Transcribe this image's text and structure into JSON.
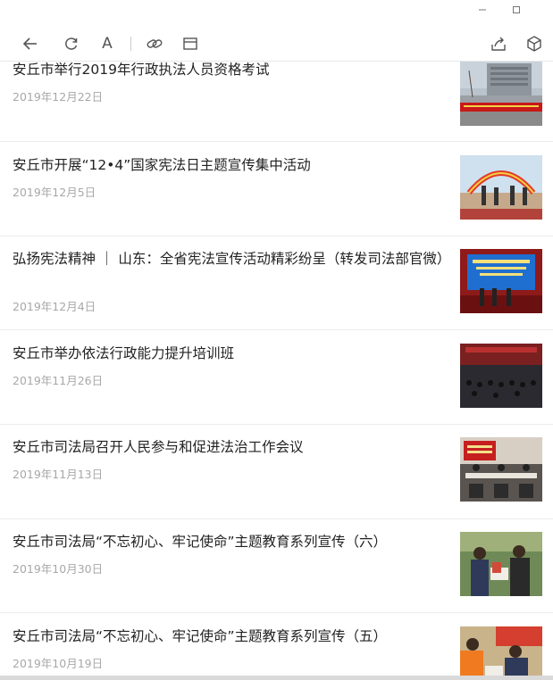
{
  "window": {
    "minimize_icon": "minimize-icon",
    "maximize_icon": "maximize-icon"
  },
  "toolbar": {
    "icons": [
      "back-arrow-icon",
      "refresh-icon",
      "font-size-icon",
      "link-icon",
      "window-icon",
      "share-icon",
      "cube-icon"
    ],
    "font_glyph": "A"
  },
  "articles": [
    {
      "title": "安丘市举行2019年行政执法人员资格考试",
      "date": "2019年12月22日",
      "thumb": "building-exam-photo"
    },
    {
      "title": "安丘市开展“12•4”国家宪法日主题宣传集中活动",
      "date": "2019年12月5日",
      "thumb": "outdoor-arch-event-photo"
    },
    {
      "title": "弘扬宪法精神 ｜ 山东：全省宪法宣传活动精彩纷呈（转发司法部官微）",
      "date": "2019年12月4日",
      "thumb": "stage-event-photo"
    },
    {
      "title": "安丘市举办依法行政能力提升培训班",
      "date": "2019年11月26日",
      "thumb": "auditorium-training-photo"
    },
    {
      "title": "安丘市司法局召开人民参与和促进法治工作会议",
      "date": "2019年11月13日",
      "thumb": "meeting-room-photo"
    },
    {
      "title": "安丘市司法局“不忘初心、牢记使命”主题教育系列宣传（六）",
      "date": "2019年10月30日",
      "thumb": "people-reading-photo"
    },
    {
      "title": "安丘市司法局“不忘初心、牢记使命”主题教育系列宣传（五）",
      "date": "2019年10月19日",
      "thumb": "outreach-photo"
    }
  ],
  "colors": {
    "title": "#222222",
    "date": "#a8a8a8",
    "separator": "#ececec",
    "icon": "#555555"
  }
}
